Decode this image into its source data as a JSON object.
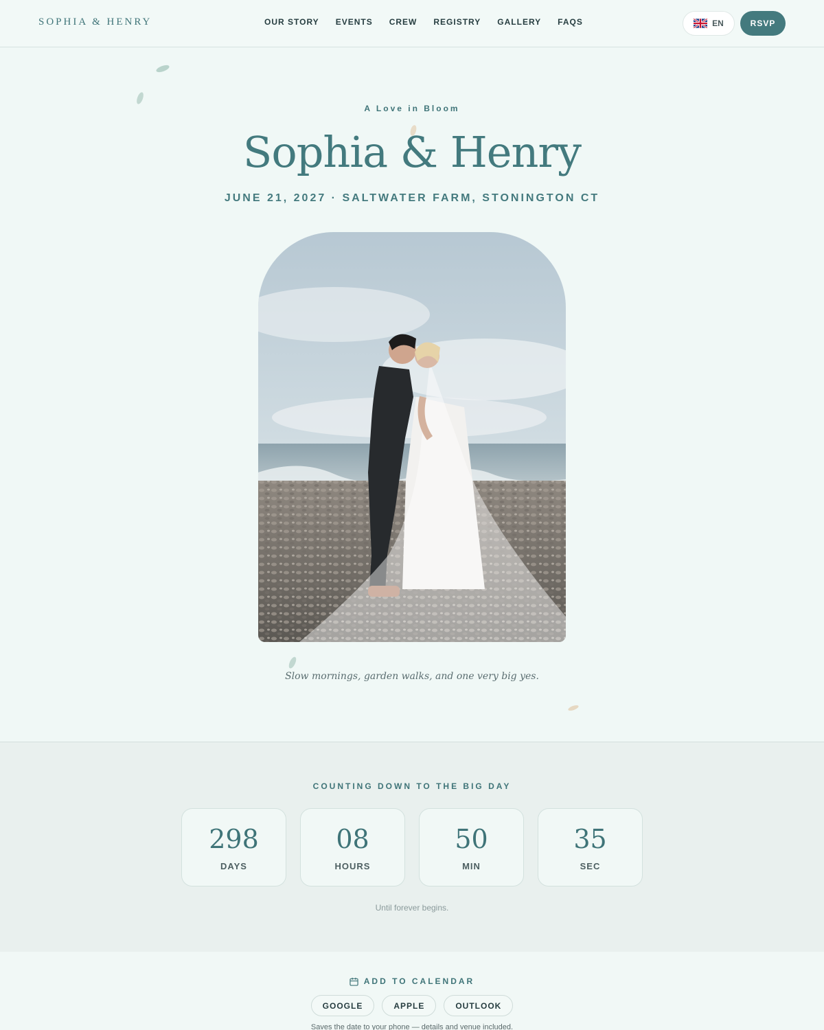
{
  "header": {
    "brand": "SOPHIA & HENRY",
    "nav": [
      "OUR STORY",
      "EVENTS",
      "CREW",
      "REGISTRY",
      "GALLERY",
      "FAQS"
    ],
    "language": {
      "label": "EN",
      "flag": "uk-flag-icon"
    },
    "rsvp_label": "RSVP"
  },
  "hero": {
    "tagline": "A Love in Bloom",
    "title": "Sophia & Henry",
    "subtitle": "JUNE 21, 2027 · SALTWATER FARM, STONINGTON CT",
    "caption": "Slow mornings, garden walks, and one very big yes."
  },
  "countdown": {
    "heading": "COUNTING DOWN TO THE BIG DAY",
    "units": [
      {
        "value": "298",
        "label": "DAYS"
      },
      {
        "value": "08",
        "label": "HOURS"
      },
      {
        "value": "50",
        "label": "MIN"
      },
      {
        "value": "35",
        "label": "SEC"
      }
    ],
    "note": "Until forever begins."
  },
  "calendar": {
    "icon": "calendar-icon",
    "heading": "ADD TO CALENDAR",
    "buttons": [
      "GOOGLE",
      "APPLE",
      "OUTLOOK"
    ],
    "note": "Saves the date to your phone — details and venue included."
  },
  "colors": {
    "accent": "#447a7e",
    "background": "#f0f8f6",
    "section_alt": "#e9f0ee"
  }
}
